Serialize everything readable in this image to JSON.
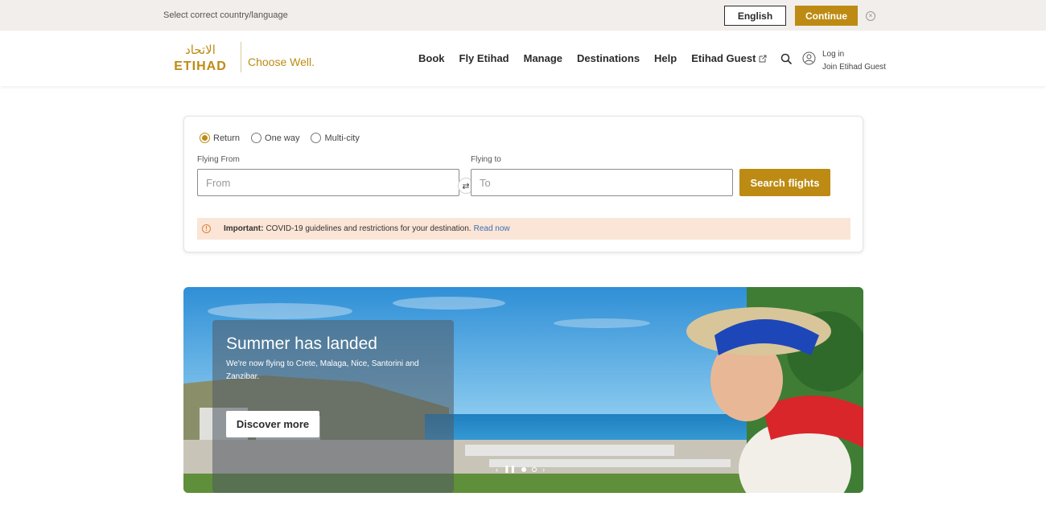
{
  "country_bar": {
    "label": "Select correct country/language",
    "language_button": "English",
    "continue_button": "Continue",
    "close": "×"
  },
  "header": {
    "logo_arabic": "الاتحاد",
    "logo_text": "ETIHAD",
    "tagline": "Choose Well.",
    "nav": [
      "Book",
      "Fly Etihad",
      "Manage",
      "Destinations",
      "Help",
      "Etihad Guest"
    ],
    "login": "Log in",
    "join": "Join Etihad Guest"
  },
  "booking": {
    "trip_types": [
      "Return",
      "One way",
      "Multi-city"
    ],
    "selected_trip": "Return",
    "from_label": "Flying From",
    "from_placeholder": "From",
    "to_label": "Flying to",
    "to_placeholder": "To",
    "swap": "⇄",
    "search_button": "Search flights",
    "notice_strong": "Important:",
    "notice_text": "COVID-19 guidelines and restrictions for your destination.",
    "notice_link": "Read now"
  },
  "hero": {
    "title": "Summer has landed",
    "text": "We're now flying to Crete, Malaga, Nice, Santorini and Zanzibar.",
    "button": "Discover more",
    "prev": "‹",
    "pause": "❚❚",
    "next": "›"
  },
  "colors": {
    "accent": "#bd8b13",
    "notice_bg": "#fbe5d6",
    "country_bar_bg": "#f1eeec"
  }
}
